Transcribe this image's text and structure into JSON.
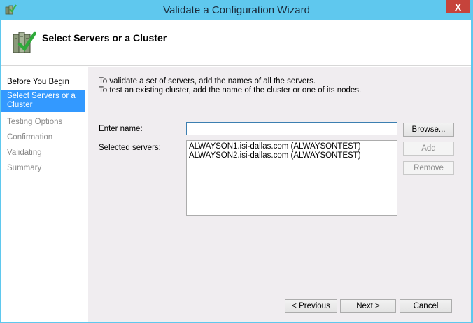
{
  "window": {
    "title": "Validate a Configuration Wizard",
    "close_glyph": "X"
  },
  "header": {
    "title": "Select Servers or a Cluster"
  },
  "sidebar": {
    "items": [
      {
        "label": "Before You Begin",
        "state": "done"
      },
      {
        "label": "Select Servers or a Cluster",
        "state": "active"
      },
      {
        "label": "Testing Options",
        "state": "pending"
      },
      {
        "label": "Confirmation",
        "state": "pending"
      },
      {
        "label": "Validating",
        "state": "pending"
      },
      {
        "label": "Summary",
        "state": "pending"
      }
    ]
  },
  "main": {
    "instruction_line1": "To validate a set of servers, add the names of all the servers.",
    "instruction_line2": "To test an existing cluster, add the name of the cluster or one of its nodes.",
    "enter_name_label": "Enter name:",
    "enter_name_value": "",
    "browse_label": "Browse...",
    "selected_servers_label": "Selected servers:",
    "selected_servers": [
      "ALWAYSON1.isi-dallas.com (ALWAYSONTEST)",
      "ALWAYSON2.isi-dallas.com (ALWAYSONTEST)"
    ],
    "add_label": "Add",
    "remove_label": "Remove"
  },
  "footer": {
    "previous_label": "< Previous",
    "next_label": "Next >",
    "cancel_label": "Cancel"
  },
  "colors": {
    "titlebar": "#5fc8ee",
    "selection": "#3399ff",
    "close": "#c6433b",
    "panel": "#f0edf0"
  }
}
